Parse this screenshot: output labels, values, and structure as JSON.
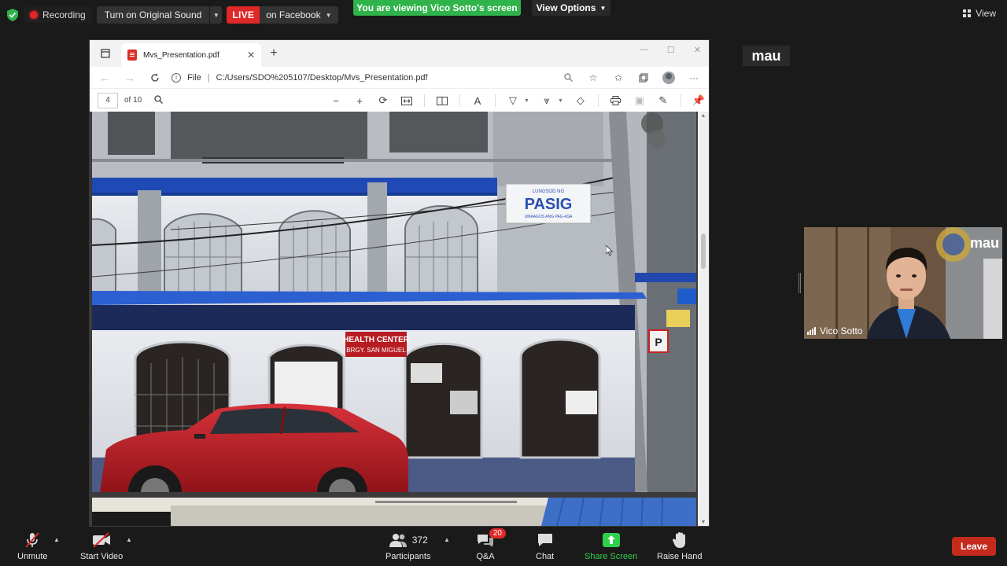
{
  "topbar": {
    "recording_label": "Recording",
    "sound_label": "Turn on Original Sound",
    "live_badge": "LIVE",
    "live_target": "on Facebook",
    "viewing_banner": "You are viewing Vico Sotto's screen",
    "view_options": "View Options",
    "view_label": "View"
  },
  "browser": {
    "tab_title": "Mvs_Presentation.pdf",
    "address_scheme": "File",
    "address_path": "C:/Users/SDO%205107/Desktop/Mvs_Presentation.pdf",
    "page_current": "4",
    "page_total": "of 10"
  },
  "slide_signs": {
    "building_sign_line1": "LUNGSOD NG",
    "building_sign_line2": "PASIG",
    "building_sign_line3": "UMAAGOS ANG PAG-ASA",
    "center_sign_line1": "HEALTH CENTER",
    "center_sign_line2": "BRGY. SAN MIGUEL"
  },
  "right_panel": {
    "presenter_label": "mau",
    "video_overlay_label": "mau",
    "participant_name": "Vico Sotto"
  },
  "bottombar": {
    "unmute": "Unmute",
    "start_video": "Start Video",
    "participants_count": "372",
    "participants": "Participants",
    "qa": "Q&A",
    "qa_badge": "20",
    "chat": "Chat",
    "share_screen": "Share Screen",
    "raise_hand": "Raise Hand",
    "leave": "Leave"
  },
  "colors": {
    "live_red": "#e02828",
    "banner_green": "#2fb34a",
    "share_green": "#2fd04d",
    "leave_red": "#c42b1c"
  }
}
